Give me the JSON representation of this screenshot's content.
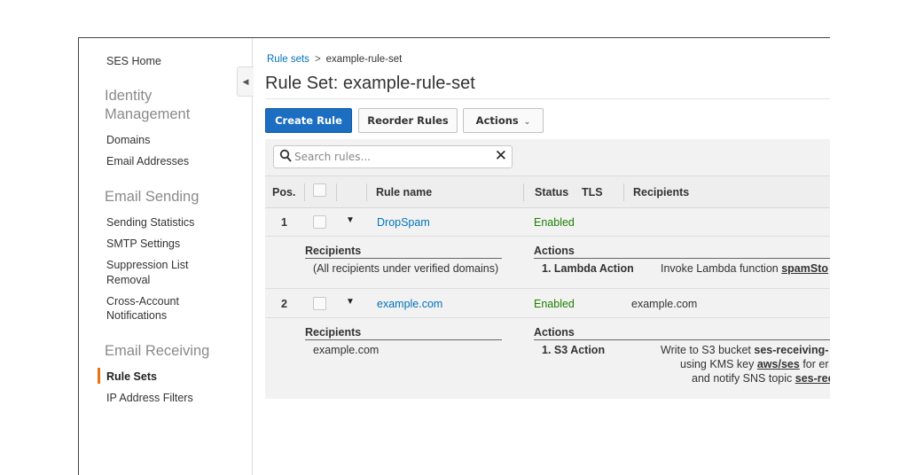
{
  "sidebar": {
    "home": "SES Home",
    "identity_heading": "Identity Management",
    "identity_line1": "Identity",
    "identity_line2": "Management",
    "domains": "Domains",
    "email_addresses": "Email Addresses",
    "sending_heading": "Email Sending",
    "sending_statistics": "Sending Statistics",
    "smtp_settings": "SMTP Settings",
    "suppression_line1": "Suppression List",
    "suppression_line2": "Removal",
    "cross_line1": "Cross-Account",
    "cross_line2": "Notifications",
    "receiving_heading": "Email Receiving",
    "rule_sets": "Rule Sets",
    "ip_filters": "IP Address Filters"
  },
  "breadcrumb": {
    "parent": "Rule sets",
    "separator": ">",
    "current": "example-rule-set"
  },
  "page": {
    "title": "Rule Set: example-rule-set"
  },
  "toolbar": {
    "create": "Create Rule",
    "reorder": "Reorder Rules",
    "actions": "Actions"
  },
  "search": {
    "placeholder": "Search rules..."
  },
  "columns": {
    "pos": "Pos.",
    "rule_name": "Rule name",
    "status": "Status",
    "tls": "TLS",
    "recipients": "Recipients"
  },
  "rules": [
    {
      "pos": "1",
      "name": "DropSpam",
      "status": "Enabled",
      "recipients_summary": "",
      "recipients_heading": "Recipients",
      "recipients_detail": "(All recipients under verified domains)",
      "actions_heading": "Actions",
      "action_name": "1. Lambda Action",
      "action_desc_prefix": "Invoke Lambda function",
      "action_desc_target": "spamSto"
    },
    {
      "pos": "2",
      "name": "example.com",
      "status": "Enabled",
      "recipients_summary": "example.com",
      "recipients_heading": "Recipients",
      "recipients_detail": "example.com",
      "actions_heading": "Actions",
      "action_name": "1. S3 Action",
      "line1_prefix": "Write to S3 bucket",
      "line1_target": "ses-receiving-",
      "line2_prefix": "using KMS key",
      "line2_target": "aws/ses",
      "line2_suffix": "for er",
      "line3_prefix": "and notify SNS topic",
      "line3_target": "ses-rece"
    }
  ],
  "colors": {
    "accent": "#ec7211",
    "primary_button": "#1b6ec2",
    "link": "#0073bb",
    "enabled": "#1d8102"
  }
}
